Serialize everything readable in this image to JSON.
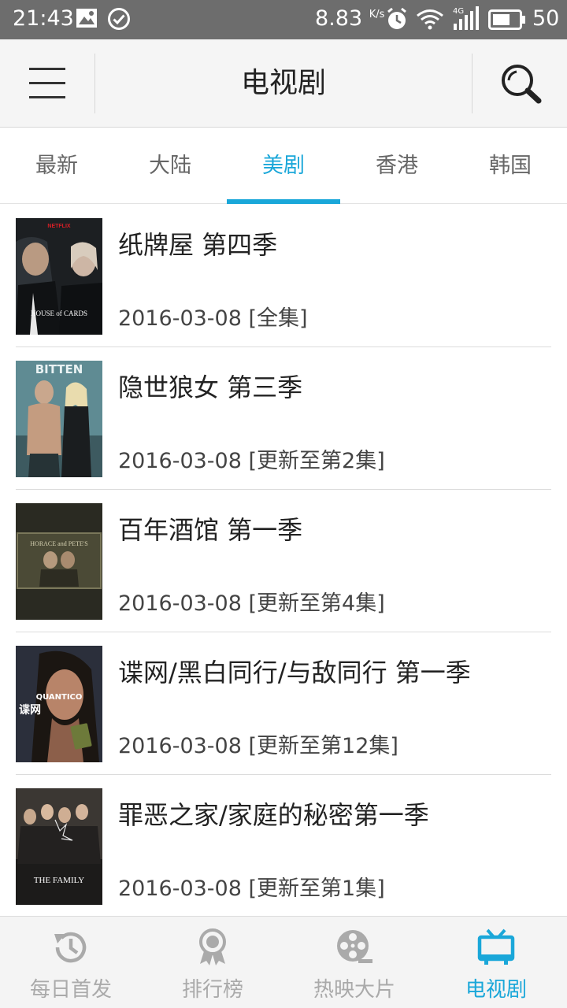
{
  "status_bar": {
    "time": "21:43",
    "net_speed": "8.83",
    "net_speed_unit": "K/s",
    "network": "4G",
    "battery": "50",
    "icons": [
      "image-icon",
      "check-circle-icon",
      "alarm-icon",
      "wifi-icon",
      "signal-icon",
      "battery-icon"
    ]
  },
  "header": {
    "title": "电视剧",
    "menu_icon": "menu-icon",
    "search_icon": "search-icon"
  },
  "tabs": [
    {
      "label": "最新",
      "active": false
    },
    {
      "label": "大陆",
      "active": false
    },
    {
      "label": "美剧",
      "active": true
    },
    {
      "label": "香港",
      "active": false
    },
    {
      "label": "韩国",
      "active": false
    }
  ],
  "list": [
    {
      "title": "纸牌屋 第四季",
      "date": "2016-03-08",
      "status": "[全集]",
      "poster_text": "HOUSE of CARDS",
      "poster_top": "NETFLIX"
    },
    {
      "title": "隐世狼女 第三季",
      "date": "2016-03-08",
      "status": "[更新至第2集]",
      "poster_text": "BITTEN"
    },
    {
      "title": "百年酒馆 第一季",
      "date": "2016-03-08",
      "status": "[更新至第4集]",
      "poster_text": "HORACE and PETE'S"
    },
    {
      "title": "谍网/黑白同行/与敌同行 第一季",
      "date": "2016-03-08",
      "status": "[更新至第12集]",
      "poster_text": "QUANTICO",
      "poster_sub": "谍网"
    },
    {
      "title": "罪恶之家/家庭的秘密第一季",
      "date": "2016-03-08",
      "status": "[更新至第1集]",
      "poster_text": "THE FAMILY"
    }
  ],
  "bottom_nav": [
    {
      "label": "每日首发",
      "icon": "history-icon",
      "active": false
    },
    {
      "label": "排行榜",
      "icon": "ribbon-award-icon",
      "active": false
    },
    {
      "label": "热映大片",
      "icon": "film-reel-icon",
      "active": false
    },
    {
      "label": "电视剧",
      "icon": "tv-icon",
      "active": true
    }
  ],
  "colors": {
    "accent": "#1aa7d9",
    "status_bar": "#6d6d6d",
    "header_bg": "#f5f5f5",
    "inactive_nav": "#aaaaaa"
  }
}
